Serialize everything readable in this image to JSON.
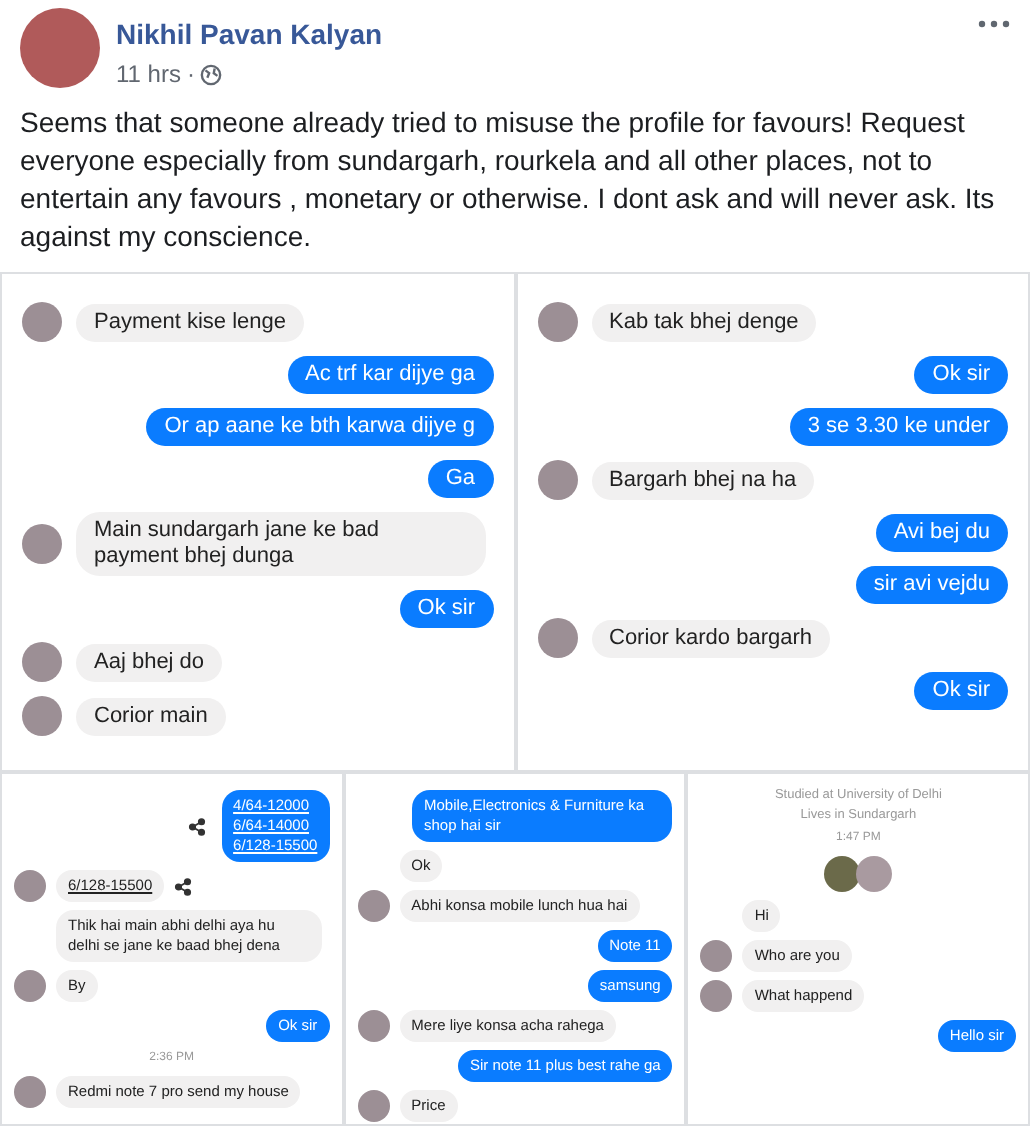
{
  "post": {
    "author": "Nikhil Pavan Kalyan",
    "time": "11 hrs",
    "separator": "·",
    "text": "Seems that someone already tried to misuse the profile for favours! Request everyone especially from sundargarh, rourkela and all other places, not to entertain any favours , monetary or otherwise. I dont ask and will never ask. Its against my conscience."
  },
  "top_screenshots": [
    {
      "items": [
        {
          "kind": "in",
          "avatar": true,
          "text": "Payment kise lenge"
        },
        {
          "kind": "out",
          "text": "Ac trf kar dijye ga"
        },
        {
          "kind": "out",
          "text": "Or ap aane ke bth karwa dijye g"
        },
        {
          "kind": "out",
          "text": "Ga"
        },
        {
          "kind": "in",
          "avatar": true,
          "text": "Main sundargarh jane ke bad payment bhej dunga"
        },
        {
          "kind": "out",
          "text": "Ok sir"
        },
        {
          "kind": "in",
          "avatar": true,
          "text": "Aaj bhej do"
        },
        {
          "kind": "in",
          "avatar": true,
          "text": "Corior main"
        }
      ]
    },
    {
      "items": [
        {
          "kind": "in",
          "avatar": true,
          "text": "Kab tak bhej denge"
        },
        {
          "kind": "out",
          "text": "Ok sir"
        },
        {
          "kind": "out",
          "text": "3 se 3.30 ke under"
        },
        {
          "kind": "in",
          "avatar": true,
          "text": "Bargarh bhej na ha"
        },
        {
          "kind": "out",
          "text": "Avi bej du"
        },
        {
          "kind": "out",
          "text": "sir avi vejdu"
        },
        {
          "kind": "in",
          "avatar": true,
          "text": "Corior kardo bargarh"
        },
        {
          "kind": "out",
          "text": "Ok sir"
        }
      ]
    }
  ],
  "bottom_screenshots": [
    {
      "items": [
        {
          "kind": "out",
          "share": true,
          "link": true,
          "text": "4/64-12000\n6/64-14000\n6/128-15500"
        },
        {
          "kind": "in",
          "avatar": true,
          "share": true,
          "link": true,
          "text": "6/128-15500"
        },
        {
          "kind": "in",
          "avatar": false,
          "text": "Thik hai main abhi delhi aya hu delhi se jane ke baad bhej dena"
        },
        {
          "kind": "in",
          "avatar": true,
          "text": "By"
        },
        {
          "kind": "out",
          "text": "Ok sir"
        },
        {
          "kind": "time",
          "text": "2:36 PM"
        },
        {
          "kind": "in",
          "avatar": true,
          "text": "Redmi note 7 pro send my house"
        }
      ]
    },
    {
      "items": [
        {
          "kind": "out",
          "text": "Mobile,Electronics & Furniture ka shop hai sir"
        },
        {
          "kind": "in",
          "avatar": false,
          "text": "Ok"
        },
        {
          "kind": "in",
          "avatar": true,
          "text": "Abhi konsa mobile lunch hua hai"
        },
        {
          "kind": "out",
          "text": "Note 11"
        },
        {
          "kind": "out",
          "text": "samsung"
        },
        {
          "kind": "in",
          "avatar": true,
          "text": "Mere liye konsa acha rahega"
        },
        {
          "kind": "out",
          "text": "Sir note 11 plus best rahe ga"
        },
        {
          "kind": "in",
          "avatar": true,
          "text": "Price"
        }
      ]
    },
    {
      "items": [
        {
          "kind": "info",
          "text": "Studied at University of Delhi"
        },
        {
          "kind": "info",
          "text": "Lives in Sundargarh"
        },
        {
          "kind": "time",
          "text": "1:47 PM"
        },
        {
          "kind": "avatars"
        },
        {
          "kind": "in",
          "avatar": false,
          "text": "Hi"
        },
        {
          "kind": "in",
          "avatar": true,
          "text": "Who are you"
        },
        {
          "kind": "in",
          "avatar": true,
          "text": "What happend"
        },
        {
          "kind": "out",
          "text": "Hello sir"
        }
      ]
    }
  ]
}
